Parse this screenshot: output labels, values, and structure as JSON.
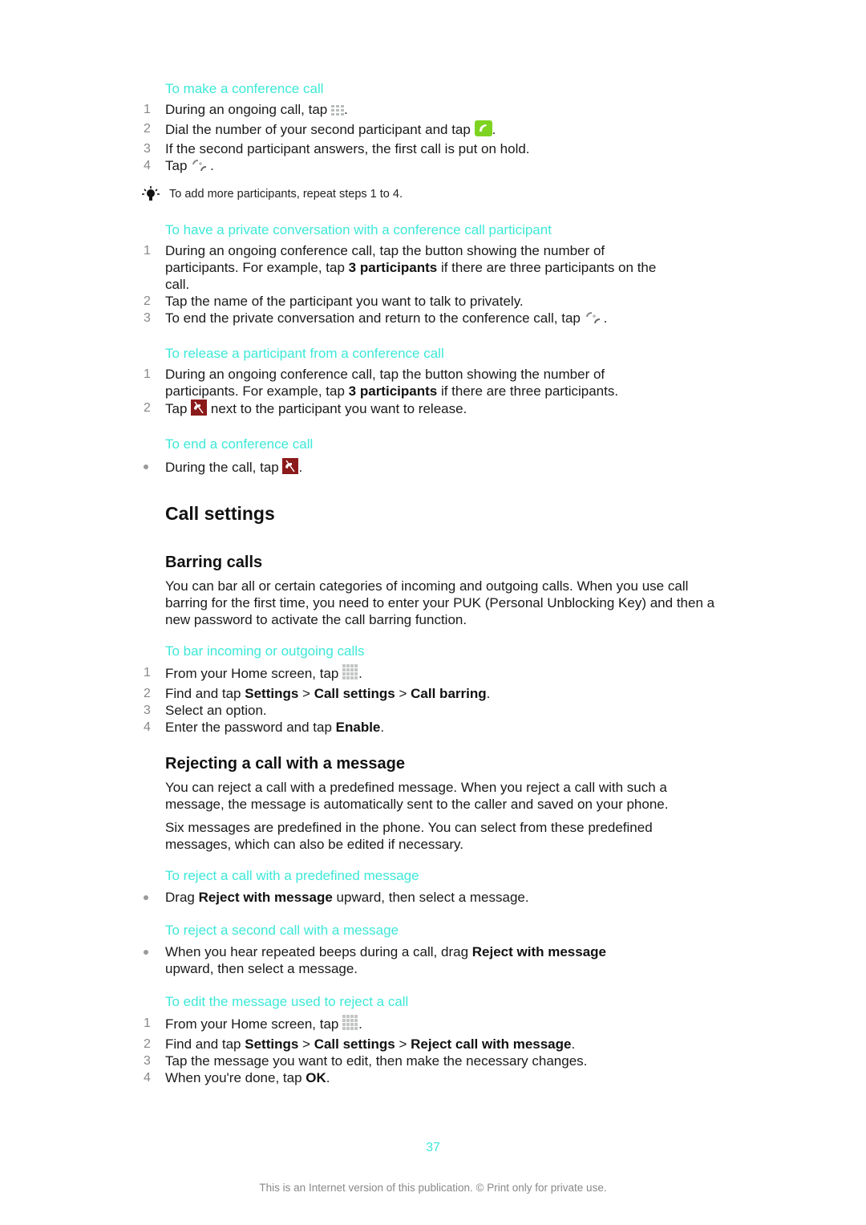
{
  "sections": {
    "make_conference": {
      "title": "To make a conference call",
      "steps": [
        {
          "num": "1",
          "text_before": "During an ongoing call, tap ",
          "icon": "dialpad-icon",
          "text_after": "."
        },
        {
          "num": "2",
          "text_before": "Dial the number of your second participant and tap ",
          "icon": "green-call-icon",
          "text_after": "."
        },
        {
          "num": "3",
          "text": "If the second participant answers, the first call is put on hold."
        },
        {
          "num": "4",
          "text_before": "Tap ",
          "icon": "merge-calls-icon",
          "text_after": "."
        }
      ],
      "tip": {
        "icon": "lightbulb-tip-icon",
        "text": "To add more participants, repeat steps 1 to 4."
      }
    },
    "private_conversation": {
      "title": "To have a private conversation with a conference call participant",
      "steps": [
        {
          "num": "1",
          "text_before": "During an ongoing conference call, tap the button showing the number of participants. For example, tap ",
          "bold": "3 participants",
          "text_after": " if there are three participants on the call."
        },
        {
          "num": "2",
          "text": "Tap the name of the participant you want to talk to privately."
        },
        {
          "num": "3",
          "text_before": "To end the private conversation and return to the conference call, tap ",
          "icon": "merge-calls-icon",
          "text_after": "."
        }
      ]
    },
    "release_participant": {
      "title": "To release a participant from a conference call",
      "steps": [
        {
          "num": "1",
          "text_before": "During an ongoing conference call, tap the button showing the number of participants. For example, tap ",
          "bold": "3 participants",
          "text_after": " if there are three participants."
        },
        {
          "num": "2",
          "text_before": "Tap ",
          "icon": "end-call-icon",
          "text_after": " next to the participant you want to release."
        }
      ]
    },
    "end_conference": {
      "title": "To end a conference call",
      "steps": [
        {
          "text_before": "During the call, tap ",
          "icon": "end-call-icon",
          "text_after": "."
        }
      ]
    }
  },
  "call_settings": {
    "heading": "Call settings",
    "barring": {
      "heading": "Barring calls",
      "paragraph": "You can bar all or certain categories of incoming and outgoing calls. When you use call barring for the first time, you need to enter your PUK (Personal Unblocking Key) and then a new password to activate the call barring function.",
      "task_title": "To bar incoming or outgoing calls",
      "steps": [
        {
          "num": "1",
          "text_before": "From your Home screen, tap ",
          "icon": "app-grid-icon",
          "text_after": "."
        },
        {
          "num": "2",
          "text_before": "Find and tap ",
          "b1": "Settings",
          "sep1": " > ",
          "b2": "Call settings",
          "sep2": " > ",
          "b3": "Call barring",
          "text_after": "."
        },
        {
          "num": "3",
          "text": "Select an option."
        },
        {
          "num": "4",
          "text_before": "Enter the password and tap ",
          "bold": "Enable",
          "text_after": "."
        }
      ]
    },
    "rejecting": {
      "heading": "Rejecting a call with a message",
      "paragraph1": "You can reject a call with a predefined message. When you reject a call with such a message, the message is automatically sent to the caller and saved on your phone.",
      "paragraph2": "Six messages are predefined in the phone. You can select from these predefined messages, which can also be edited if necessary.",
      "reject_predefined": {
        "title": "To reject a call with a predefined message",
        "text_before": "Drag ",
        "bold": "Reject with message",
        "text_after": " upward, then select a message."
      },
      "reject_second": {
        "title": "To reject a second call with a message",
        "text_before": "When you hear repeated beeps during a call, drag ",
        "bold": "Reject with message",
        "text_after": " upward, then select a message."
      },
      "edit_message": {
        "title": "To edit the message used to reject a call",
        "steps": [
          {
            "num": "1",
            "text_before": "From your Home screen, tap ",
            "icon": "app-grid-icon",
            "text_after": "."
          },
          {
            "num": "2",
            "text_before": "Find and tap ",
            "b1": "Settings",
            "sep1": " > ",
            "b2": "Call settings",
            "sep2": " > ",
            "b3": "Reject call with message",
            "text_after": "."
          },
          {
            "num": "3",
            "text": "Tap the message you want to edit, then make the necessary changes."
          },
          {
            "num": "4",
            "text_before": "When you're done, tap ",
            "bold": "OK",
            "text_after": "."
          }
        ]
      }
    }
  },
  "footer": {
    "page_number": "37",
    "note": "This is an Internet version of this publication. © Print only for private use."
  },
  "colors": {
    "accent": "#3de8d8",
    "step_number": "#888888",
    "call_green": "#7ed321",
    "end_call_red": "#8b1a1a"
  }
}
